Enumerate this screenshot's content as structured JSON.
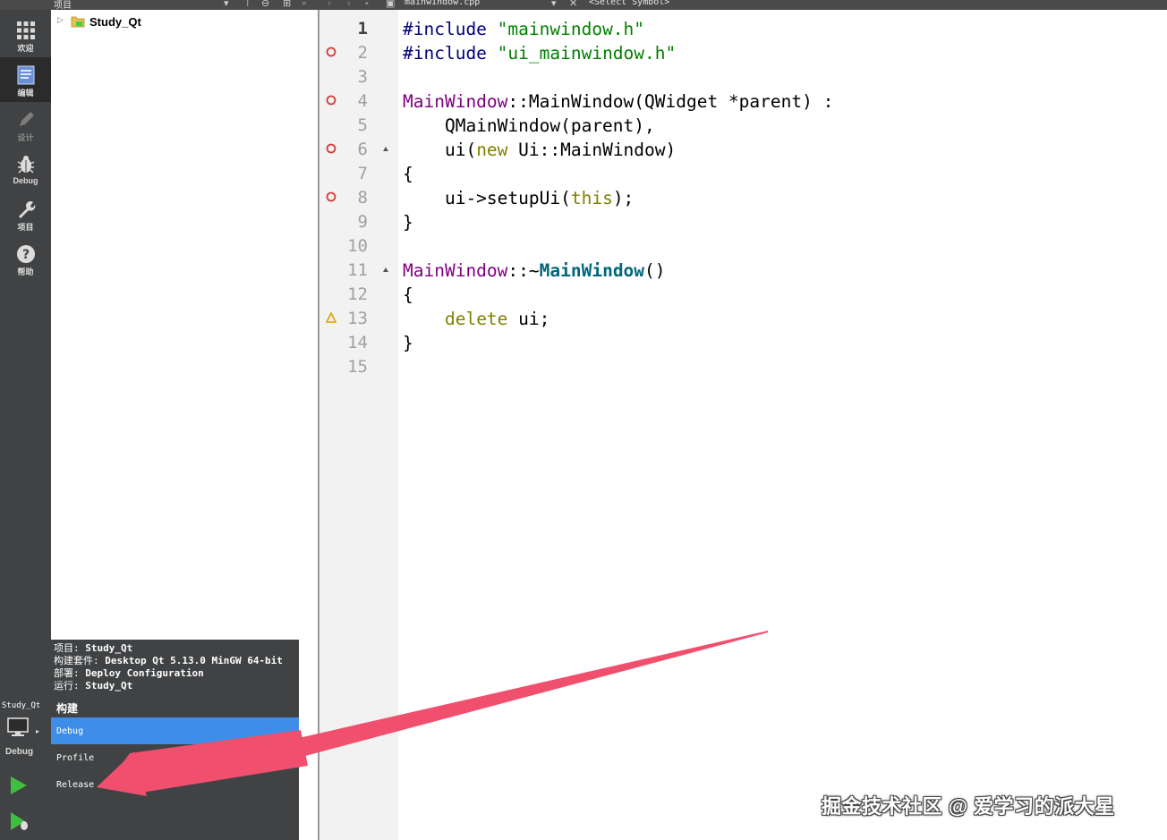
{
  "toolbar": {
    "project_label": "项目",
    "file_name": "mainwindow.cpp",
    "symbol_placeholder": "<Select Symbol>"
  },
  "modes": [
    {
      "label": "欢迎",
      "icon": "grid-icon"
    },
    {
      "label": "编辑",
      "icon": "document-icon"
    },
    {
      "label": "设计",
      "icon": "pencil-icon"
    },
    {
      "label": "Debug",
      "icon": "bug-icon"
    },
    {
      "label": "项目",
      "icon": "wrench-icon"
    },
    {
      "label": "帮助",
      "icon": "help-icon"
    }
  ],
  "tree": {
    "project_name": "Study_Qt"
  },
  "editor": {
    "current_line": 1,
    "line_numbers": [
      "1",
      "2",
      "3",
      "4",
      "5",
      "6",
      "7",
      "8",
      "9",
      "10",
      "11",
      "12",
      "13",
      "14",
      "15"
    ],
    "lines": [
      {
        "text": "#include \"mainwindow.h\""
      },
      {
        "text": "#include \"ui_mainwindow.h\""
      },
      {
        "text": ""
      },
      {
        "text": "MainWindow::MainWindow(QWidget *parent) :"
      },
      {
        "text": "    QMainWindow(parent),"
      },
      {
        "text": "    ui(new Ui::MainWindow)"
      },
      {
        "text": "{"
      },
      {
        "text": "    ui->setupUi(this);"
      },
      {
        "text": "}"
      },
      {
        "text": ""
      },
      {
        "text": "MainWindow::~MainWindow()"
      },
      {
        "text": "{"
      },
      {
        "text": "    delete ui;"
      },
      {
        "text": "}"
      },
      {
        "text": ""
      }
    ]
  },
  "kit_selector": {
    "project_label": "项目:",
    "project_value": "Study_Qt",
    "kit_label": "构建套件:",
    "kit_value": "Desktop Qt 5.13.0 MinGW 64-bit",
    "deploy_label": "部署:",
    "deploy_value": "Deploy Configuration",
    "run_label": "运行:",
    "run_value": "Study_Qt",
    "build_heading": "构建",
    "options": [
      "Debug",
      "Profile",
      "Release"
    ],
    "selected": "Debug"
  },
  "target": {
    "project": "Study_Qt",
    "config": "Debug"
  },
  "watermark": "掘金技术社区 @ 爱学习的派大星",
  "colors": {
    "modebar": "#404244",
    "selection": "#3d8ee9",
    "arrow": "#f0506e"
  }
}
